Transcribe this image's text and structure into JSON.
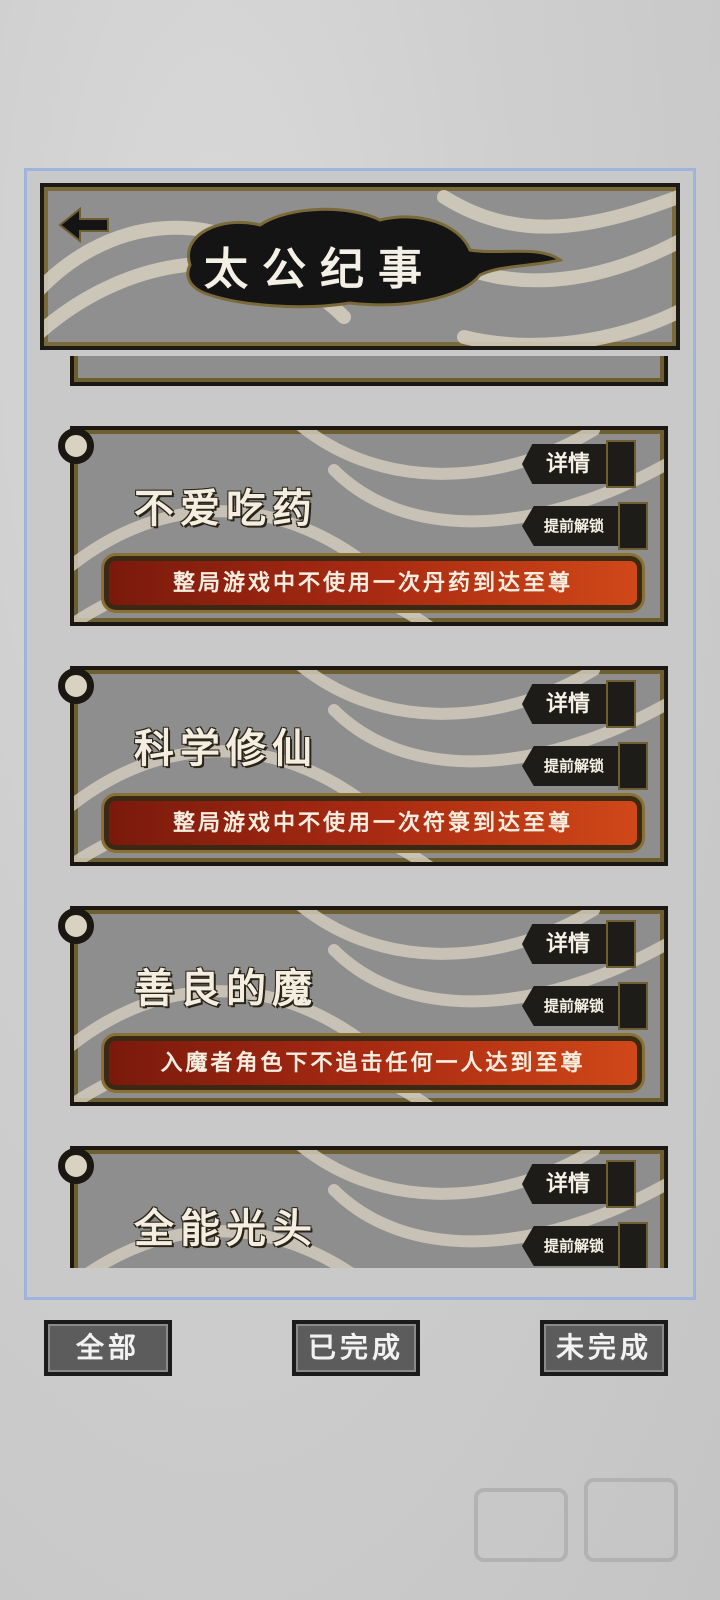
{
  "header": {
    "title": "太公纪事",
    "back_icon": "back-arrow-icon"
  },
  "cards": [
    {
      "title": "不爱吃药",
      "detail_label": "详情",
      "unlock_label": "提前解锁",
      "description": "整局游戏中不使用一次丹药到达至尊"
    },
    {
      "title": "科学修仙",
      "detail_label": "详情",
      "unlock_label": "提前解锁",
      "description": "整局游戏中不使用一次符箓到达至尊"
    },
    {
      "title": "善良的魔",
      "detail_label": "详情",
      "unlock_label": "提前解锁",
      "description": "入魔者角色下不追击任何一人达到至尊"
    },
    {
      "title": "全能光头",
      "detail_label": "详情",
      "unlock_label": "提前解锁",
      "description": ""
    }
  ],
  "tabs": {
    "all": "全部",
    "completed": "已完成",
    "incomplete": "未完成"
  },
  "colors": {
    "frame_border": "#9fb3dc",
    "desc_bar_start": "#7a1a0c",
    "desc_bar_end": "#d04818",
    "tab_bg": "#5c5c5c"
  }
}
